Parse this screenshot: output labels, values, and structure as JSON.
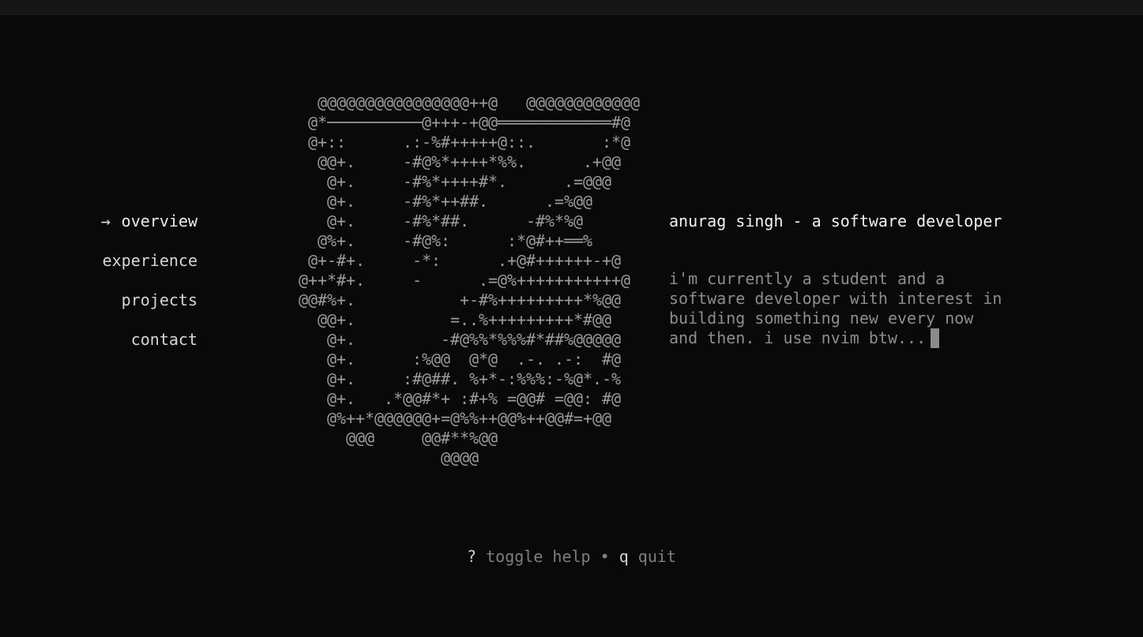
{
  "colors": {
    "background": "#090909",
    "text_bright": "#f2f2f2",
    "text_muted": "#8d8d8d",
    "ascii_art": "#9c9c9c"
  },
  "nav": {
    "items": [
      {
        "label": "overview",
        "active": true,
        "marker": "→"
      },
      {
        "label": "experience",
        "active": false
      },
      {
        "label": "projects",
        "active": false
      },
      {
        "label": "contact",
        "active": false
      }
    ]
  },
  "ascii_art": "   @@@@@@@@@@@@@@@@++@   @@@@@@@@@@@@\n  @*──────────@+++-+@@════════════#@\n  @+::      .:-%#+++++@::.       :*@\n   @@+.     -#@%*++++*%%.      .+@@\n    @+.     -#%*++++#*.      .=@@@\n    @+.     -#%*++##.      .=%@@\n    @+.     -#%*##.      -#%*%@\n   @%+.     -#@%:      :*@#++══%\n  @+-#+.     -*:      .+@#++++++-+@\n @++*#+.     -      .=@%+++++++++++@\n @@#%+.           +-#%+++++++++*%@@\n   @@+.          =..%+++++++++*#@@\n    @+.         -#@%%*%%%#*##%@@@@@\n    @+.      :%@@  @*@  .-. .-:  #@\n    @+.     :#@##. %+*-:%%%:-%@*.-%\n    @+.   .*@@#*+ :#+% =@@# =@@: #@\n    @%++*@@@@@@+=@%%++@@%++@@#=+@@\n      @@@     @@#**%@@\n                @@@@",
  "profile": {
    "title": "anurag singh - a software developer",
    "description": "i'm currently a student and a\nsoftware developer with interest in\nbuilding something new every now\nand then. i use nvim btw..."
  },
  "help": {
    "toggle_key": "?",
    "toggle_label": "toggle help",
    "separator": "•",
    "quit_key": "q",
    "quit_label": "quit"
  }
}
